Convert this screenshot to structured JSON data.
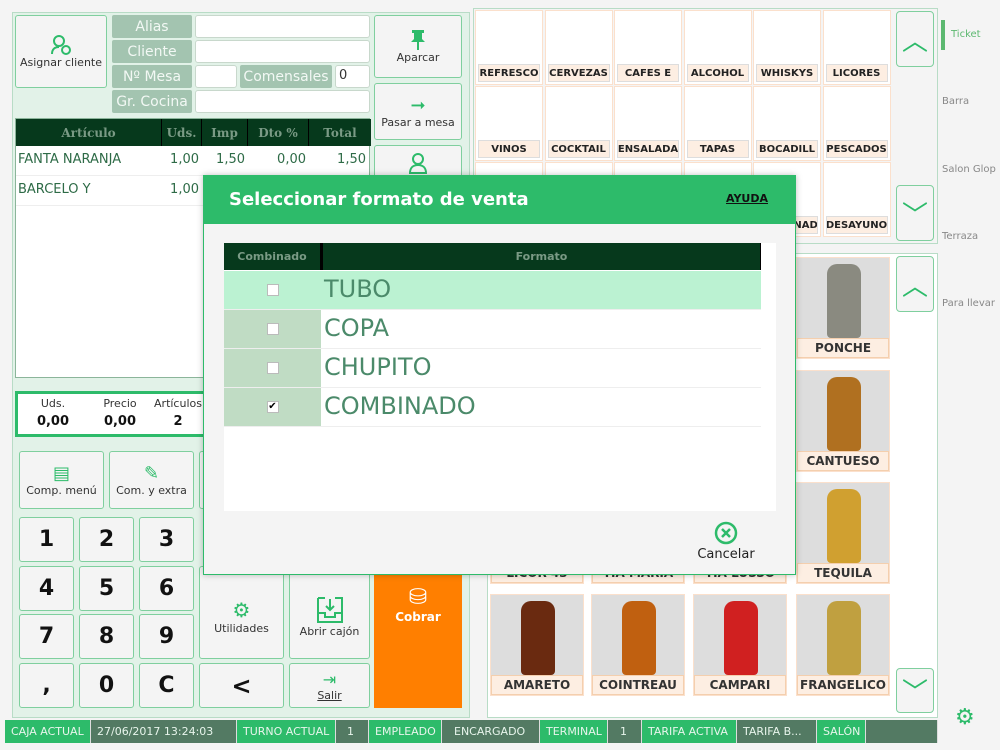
{
  "ticket": {
    "assign_client": "Asignar cliente",
    "labels": {
      "alias": "Alias",
      "cliente": "Cliente",
      "mesa": "Nº Mesa",
      "comensales": "Comensales",
      "cocina": "Gr. Cocina"
    },
    "values": {
      "alias": "",
      "cliente": "",
      "mesa": "",
      "comensales": "0",
      "cocina": ""
    },
    "side_buttons": {
      "aparcar": "Aparcar",
      "pasar": "Pasar a mesa"
    },
    "columns": [
      "Artículo",
      "Uds.",
      "Imp",
      "Dto %",
      "Total"
    ],
    "rows": [
      {
        "articulo": "FANTA NARANJA",
        "uds": "1,00",
        "imp": "1,50",
        "dto": "0,00",
        "total": "1,50"
      },
      {
        "articulo": "BARCELO Y",
        "uds": "1,00",
        "imp": "",
        "dto": "",
        "total": ""
      }
    ],
    "totals": {
      "uds_label": "Uds.",
      "uds": "0,00",
      "precio_label": "Precio",
      "precio": "0,00",
      "articulos_label": "Artículos",
      "articulos": "2"
    }
  },
  "actions": {
    "comp_menu": "Comp. menú",
    "com_extra": "Com. y extra",
    "utilidades": "Utilidades",
    "abrir_cajon": "Abrir cajón",
    "cobrar": "Cobrar",
    "salir": "Salir",
    "back": "<"
  },
  "keypad": [
    "1",
    "2",
    "3",
    "4",
    "5",
    "6",
    "7",
    "8",
    "9",
    ",",
    "0",
    "C"
  ],
  "status": {
    "caja": "CAJA ACTUAL",
    "fecha": "27/06/2017   13:24:03",
    "turno": "TURNO ACTUAL",
    "turno_val": "1",
    "empleado": "EMPLEADO",
    "empleado_val": "ENCARGADO",
    "terminal": "TERMINAL",
    "terminal_val": "1",
    "tarifa": "TARIFA ACTIVA",
    "tarifa_val": "TARIFA B...",
    "salon": "SALÓN"
  },
  "categories": [
    "REFRESCO",
    "CERVEZAS",
    "CAFES E",
    "ALCOHOL",
    "WHISKYS",
    "LICORES",
    "VINOS",
    "COCKTAIL",
    "ENSALADA",
    "TAPAS",
    "BOCADILL",
    "PESCADOS",
    "",
    "",
    "",
    "",
    "COMBINAD",
    "DESAYUNO"
  ],
  "products": [
    "PONCHE",
    "CANTUESO",
    "TEQUILA",
    "LICOR 43",
    "TIA MARIA",
    "TIA LUSSO",
    "AMARETO",
    "COINTREAU",
    "CAMPARI",
    "FRANGELICO"
  ],
  "nav": [
    "Ticket",
    "Barra",
    "Salon Glop",
    "Terraza",
    "Para llevar"
  ],
  "dialog": {
    "title": "Seleccionar formato de venta",
    "help": "AYUDA",
    "columns": [
      "Combinado",
      "Formato"
    ],
    "rows": [
      {
        "formato": "TUBO",
        "checked": false
      },
      {
        "formato": "COPA",
        "checked": false
      },
      {
        "formato": "CHUPITO",
        "checked": false
      },
      {
        "formato": "COMBINADO",
        "checked": true
      }
    ],
    "cancel": "Cancelar"
  },
  "colors": {
    "accent": "#2dbb6a",
    "header_dark": "#06391c",
    "cobrar": "#ff7f00",
    "panel": "#e2f2e8"
  }
}
